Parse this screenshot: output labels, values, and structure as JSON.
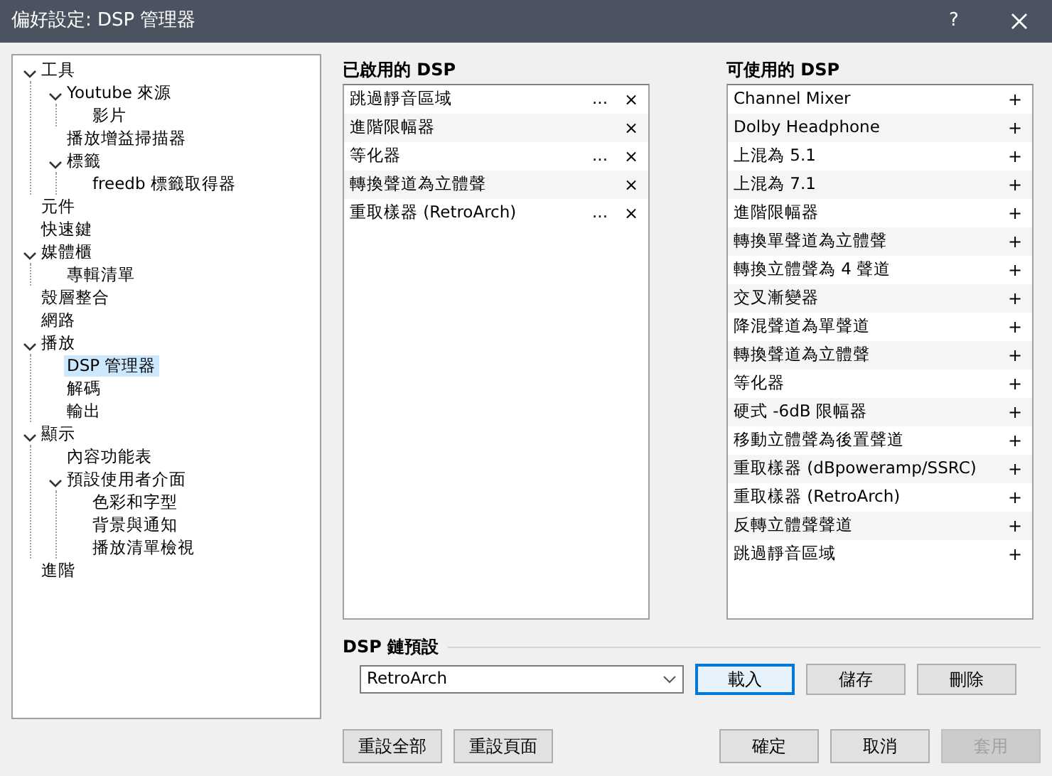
{
  "window": {
    "title": "偏好設定: DSP 管理器",
    "help": "?"
  },
  "tree": [
    {
      "label": "工具",
      "selected": false,
      "expanded": true,
      "children": [
        {
          "label": "Youtube 來源",
          "selected": false,
          "expanded": true,
          "children": [
            {
              "label": "影片",
              "selected": false
            }
          ]
        },
        {
          "label": "播放增益掃描器",
          "selected": false
        },
        {
          "label": "標籤",
          "selected": false,
          "expanded": true,
          "children": [
            {
              "label": "freedb 標籤取得器",
              "selected": false
            }
          ]
        }
      ]
    },
    {
      "label": "元件",
      "selected": false
    },
    {
      "label": "快速鍵",
      "selected": false
    },
    {
      "label": "媒體櫃",
      "selected": false,
      "expanded": true,
      "children": [
        {
          "label": "專輯清單",
          "selected": false
        }
      ]
    },
    {
      "label": "殼層整合",
      "selected": false
    },
    {
      "label": "網路",
      "selected": false
    },
    {
      "label": "播放",
      "selected": false,
      "expanded": true,
      "children": [
        {
          "label": "DSP 管理器",
          "selected": true
        },
        {
          "label": "解碼",
          "selected": false
        },
        {
          "label": "輸出",
          "selected": false
        }
      ]
    },
    {
      "label": "顯示",
      "selected": false,
      "expanded": true,
      "children": [
        {
          "label": "內容功能表",
          "selected": false
        },
        {
          "label": "預設使用者介面",
          "selected": false,
          "expanded": true,
          "children": [
            {
              "label": "色彩和字型",
              "selected": false
            },
            {
              "label": "背景與通知",
              "selected": false
            },
            {
              "label": "播放清單檢視",
              "selected": false
            }
          ]
        }
      ]
    },
    {
      "label": "進階",
      "selected": false
    }
  ],
  "active_dsp": {
    "title": "已啟用的 DSP",
    "items": [
      {
        "name": "跳過靜音區域",
        "configure": "...",
        "remove": "×"
      },
      {
        "name": "進階限幅器",
        "remove": "×"
      },
      {
        "name": "等化器",
        "configure": "...",
        "remove": "×"
      },
      {
        "name": "轉換聲道為立體聲",
        "remove": "×"
      },
      {
        "name": "重取樣器 (RetroArch)",
        "configure": "...",
        "remove": "×"
      }
    ]
  },
  "available_dsp": {
    "title": "可使用的 DSP",
    "items": [
      {
        "name": "Channel Mixer",
        "add": "+"
      },
      {
        "name": "Dolby Headphone",
        "add": "+"
      },
      {
        "name": "上混為 5.1",
        "add": "+"
      },
      {
        "name": "上混為 7.1",
        "add": "+"
      },
      {
        "name": "進階限幅器",
        "add": "+"
      },
      {
        "name": "轉換單聲道為立體聲",
        "add": "+"
      },
      {
        "name": "轉換立體聲為 4 聲道",
        "add": "+"
      },
      {
        "name": "交叉漸變器",
        "add": "+"
      },
      {
        "name": "降混聲道為單聲道",
        "add": "+"
      },
      {
        "name": "轉換聲道為立體聲",
        "add": "+"
      },
      {
        "name": "等化器",
        "add": "+"
      },
      {
        "name": "硬式 -6dB 限幅器",
        "add": "+"
      },
      {
        "name": "移動立體聲為後置聲道",
        "add": "+"
      },
      {
        "name": "重取樣器 (dBpoweramp/SSRC)",
        "add": "+"
      },
      {
        "name": "重取樣器 (RetroArch)",
        "add": "+"
      },
      {
        "name": "反轉立體聲聲道",
        "add": "+"
      },
      {
        "name": "跳過靜音區域",
        "add": "+"
      }
    ]
  },
  "preset": {
    "title": "DSP 鏈預設",
    "value": "RetroArch",
    "buttons": [
      {
        "label": "載入",
        "focused": true,
        "disabled": false
      },
      {
        "label": "儲存",
        "focused": false,
        "disabled": false
      },
      {
        "label": "刪除",
        "focused": false,
        "disabled": false
      }
    ]
  },
  "footer_left": [
    {
      "label": "重設全部",
      "disabled": false
    },
    {
      "label": "重設頁面",
      "disabled": false
    }
  ],
  "footer_right": [
    {
      "label": "確定",
      "disabled": false
    },
    {
      "label": "取消",
      "disabled": false
    },
    {
      "label": "套用",
      "disabled": true
    }
  ]
}
